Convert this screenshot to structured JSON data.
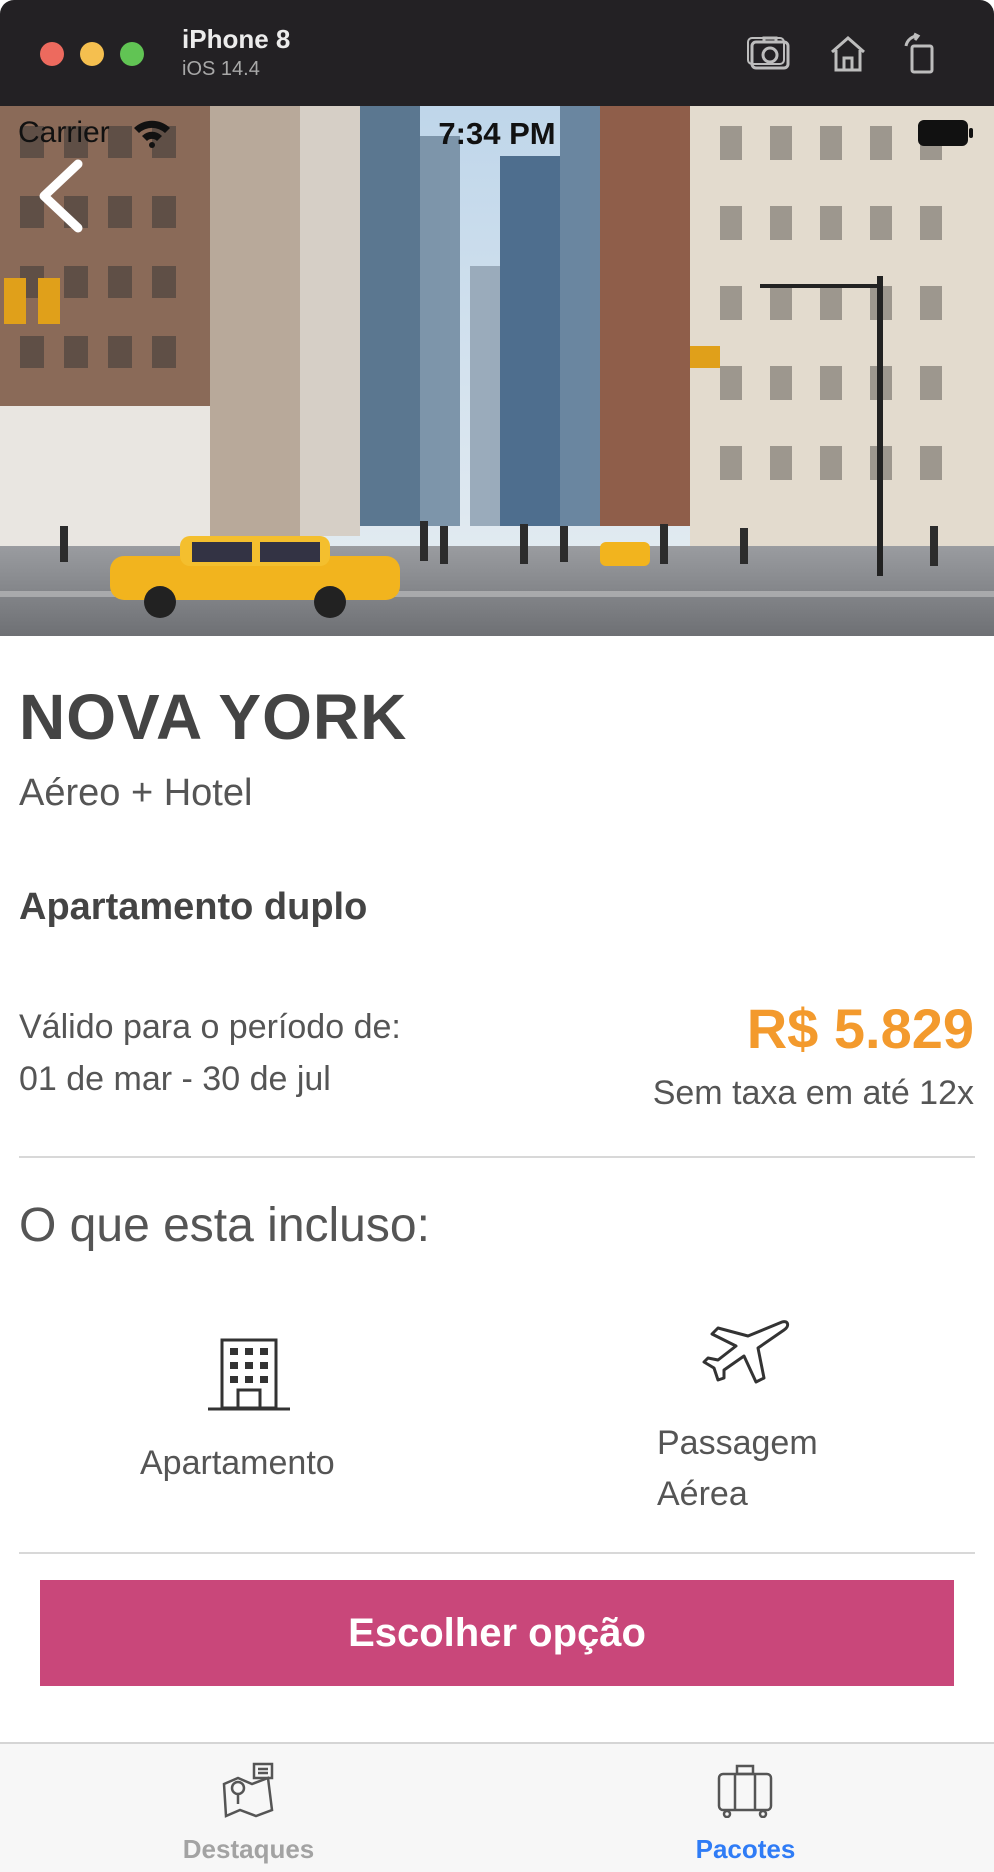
{
  "simulator": {
    "device_name": "iPhone 8",
    "os_version": "iOS 14.4",
    "toolbar_icons": [
      "screenshot-icon",
      "home-icon",
      "rotate-icon"
    ]
  },
  "status_bar": {
    "carrier": "Carrier",
    "time": "7:34 PM"
  },
  "hero": {
    "image_subject": "new-york-street-photo"
  },
  "package": {
    "title": "NOVA YORK",
    "subtitle": "Aéreo + Hotel",
    "room_type": "Apartamento duplo",
    "validity_label": "Válido para o período de:",
    "validity_dates": "01 de mar - 30 de jul",
    "price": "R$ 5.829",
    "installments": "Sem taxa em até 12x",
    "price_color": "#f39a2d"
  },
  "included": {
    "title": "O que esta incluso:",
    "items": [
      {
        "label": "Apartamento",
        "icon": "building-icon"
      },
      {
        "label": "Passagem Aérea",
        "icon": "airplane-icon"
      }
    ]
  },
  "cta": {
    "label": "Escolher opção",
    "color": "#c9477a"
  },
  "tabbar": {
    "tabs": [
      {
        "label": "Destaques",
        "icon": "map-pin-icon",
        "active": false
      },
      {
        "label": "Pacotes",
        "icon": "suitcase-icon",
        "active": true
      }
    ],
    "active_color": "#2f7cf6",
    "inactive_color": "#a3a3a3"
  }
}
